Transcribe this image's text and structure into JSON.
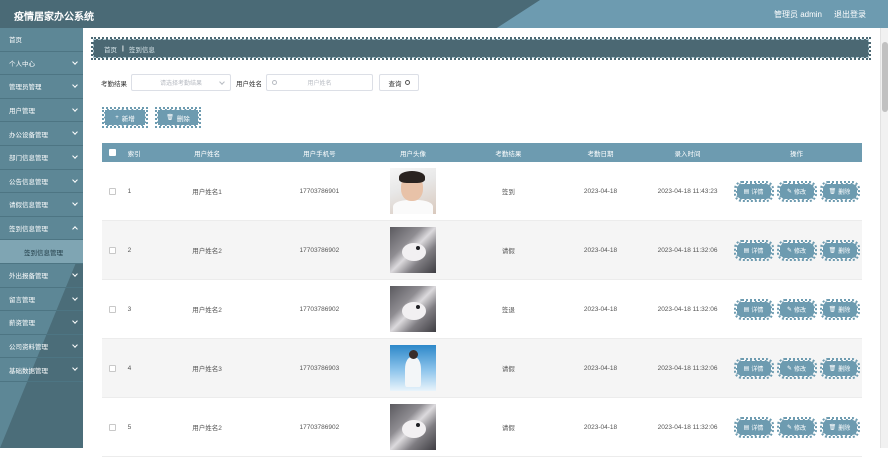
{
  "header": {
    "app_title": "疫情居家办公系统",
    "user_label": "管理员 admin",
    "logout_label": "退出登录"
  },
  "sidebar": {
    "items": [
      {
        "label": "首页",
        "has_arrow": false
      },
      {
        "label": "个人中心",
        "has_arrow": true
      },
      {
        "label": "管理员管理",
        "has_arrow": true
      },
      {
        "label": "用户管理",
        "has_arrow": true
      },
      {
        "label": "办公设备管理",
        "has_arrow": true
      },
      {
        "label": "部门信息管理",
        "has_arrow": true
      },
      {
        "label": "公告信息管理",
        "has_arrow": true
      },
      {
        "label": "请假信息管理",
        "has_arrow": true
      },
      {
        "label": "签到信息管理",
        "has_arrow": true
      },
      {
        "label": "外出报备管理",
        "has_arrow": true
      },
      {
        "label": "留言管理",
        "has_arrow": true
      },
      {
        "label": "薪资管理",
        "has_arrow": true
      },
      {
        "label": "公司资料管理",
        "has_arrow": true
      },
      {
        "label": "基础数据管理",
        "has_arrow": true
      }
    ],
    "active_sub_item": "签到信息管理"
  },
  "breadcrumb": {
    "home": "首页",
    "separator": "|",
    "current": "签到信息"
  },
  "search": {
    "result_label": "考勤结果",
    "result_placeholder": "请选择考勤结果",
    "name_label": "用户姓名",
    "name_placeholder": "用户姓名",
    "query_label": "查询"
  },
  "toolbar": {
    "add_label": "新增",
    "delete_label": "删除"
  },
  "table": {
    "columns": [
      "索引",
      "用户姓名",
      "用户手机号",
      "用户头像",
      "考勤结果",
      "考勤日期",
      "录入时间",
      "操作"
    ],
    "rows": [
      {
        "index": "1",
        "name": "用户姓名1",
        "phone": "17703786901",
        "avatar": "portrait-man",
        "result": "签到",
        "date": "2023-04-18",
        "time": "2023-04-18 11:43:23"
      },
      {
        "index": "2",
        "name": "用户姓名2",
        "phone": "17703786902",
        "avatar": "husky-dog",
        "result": "请假",
        "date": "2023-04-18",
        "time": "2023-04-18 11:32:06"
      },
      {
        "index": "3",
        "name": "用户姓名2",
        "phone": "17703786902",
        "avatar": "husky-dog",
        "result": "签退",
        "date": "2023-04-18",
        "time": "2023-04-18 11:32:06"
      },
      {
        "index": "4",
        "name": "用户姓名3",
        "phone": "17703786903",
        "avatar": "sky-figure",
        "result": "请假",
        "date": "2023-04-18",
        "time": "2023-04-18 11:32:06"
      },
      {
        "index": "5",
        "name": "用户姓名2",
        "phone": "17703786902",
        "avatar": "husky-dog",
        "result": "请假",
        "date": "2023-04-18",
        "time": "2023-04-18 11:32:06"
      }
    ],
    "ops": {
      "detail": "详情",
      "edit": "修改",
      "delete": "删除"
    }
  },
  "colors": {
    "accent": "#6d9bb0",
    "header_dark": "#4a6a76",
    "sidebar": "#5d8796"
  }
}
